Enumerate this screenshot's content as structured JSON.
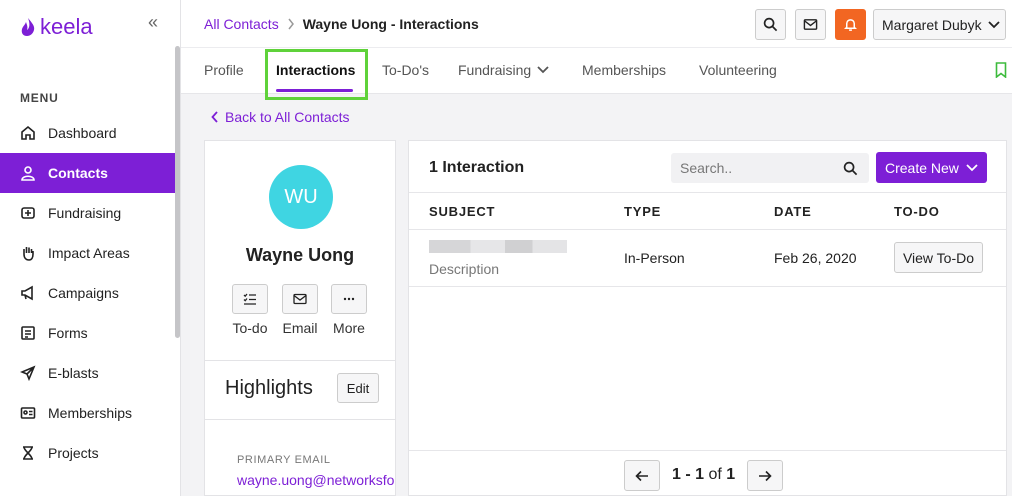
{
  "app": {
    "logo_text": "keela",
    "collapse_glyph": "«"
  },
  "sidebar": {
    "menu_label": "MENU",
    "items": [
      {
        "label": "Dashboard",
        "icon": "home-icon"
      },
      {
        "label": "Contacts",
        "icon": "user-icon",
        "active": true
      },
      {
        "label": "Fundraising",
        "icon": "fundraising-icon"
      },
      {
        "label": "Impact Areas",
        "icon": "hand-icon"
      },
      {
        "label": "Campaigns",
        "icon": "megaphone-icon"
      },
      {
        "label": "Forms",
        "icon": "form-icon"
      },
      {
        "label": "E-blasts",
        "icon": "send-icon"
      },
      {
        "label": "Memberships",
        "icon": "id-card-icon"
      },
      {
        "label": "Projects",
        "icon": "hourglass-icon"
      }
    ]
  },
  "breadcrumb": {
    "parent": "All Contacts",
    "current": "Wayne Uong - Interactions"
  },
  "header": {
    "user_name": "Margaret Dubyk"
  },
  "tabs": [
    {
      "label": "Profile"
    },
    {
      "label": "Interactions",
      "active": true
    },
    {
      "label": "To-Do's"
    },
    {
      "label": "Fundraising",
      "dropdown": true
    },
    {
      "label": "Memberships"
    },
    {
      "label": "Volunteering"
    }
  ],
  "back_link": "Back to All Contacts",
  "profile": {
    "initials": "WU",
    "avatar_color": "#3fd5e2",
    "name": "Wayne Uong",
    "actions": [
      {
        "label": "To-do",
        "icon": "checklist-icon"
      },
      {
        "label": "Email",
        "icon": "mail-icon"
      },
      {
        "label": "More",
        "icon": "ellipsis-icon"
      }
    ],
    "highlights_title": "Highlights",
    "edit_label": "Edit",
    "primary_email_label": "PRIMARY EMAIL",
    "primary_email": "wayne.uong@networksfo"
  },
  "interactions": {
    "title": "1 Interaction",
    "search_placeholder": "Search..",
    "create_label": "Create New",
    "columns": [
      "SUBJECT",
      "TYPE",
      "DATE",
      "TO-DO"
    ],
    "rows": [
      {
        "description": "Description",
        "type": "In-Person",
        "date": "Feb 26, 2020",
        "todo_label": "View To-Do"
      }
    ],
    "pagination": {
      "range": "1 - 1",
      "of_label": "of",
      "total": "1"
    }
  },
  "colors": {
    "accent": "#7d1fd6",
    "notify": "#f26622",
    "highlight": "#5fd23a"
  }
}
